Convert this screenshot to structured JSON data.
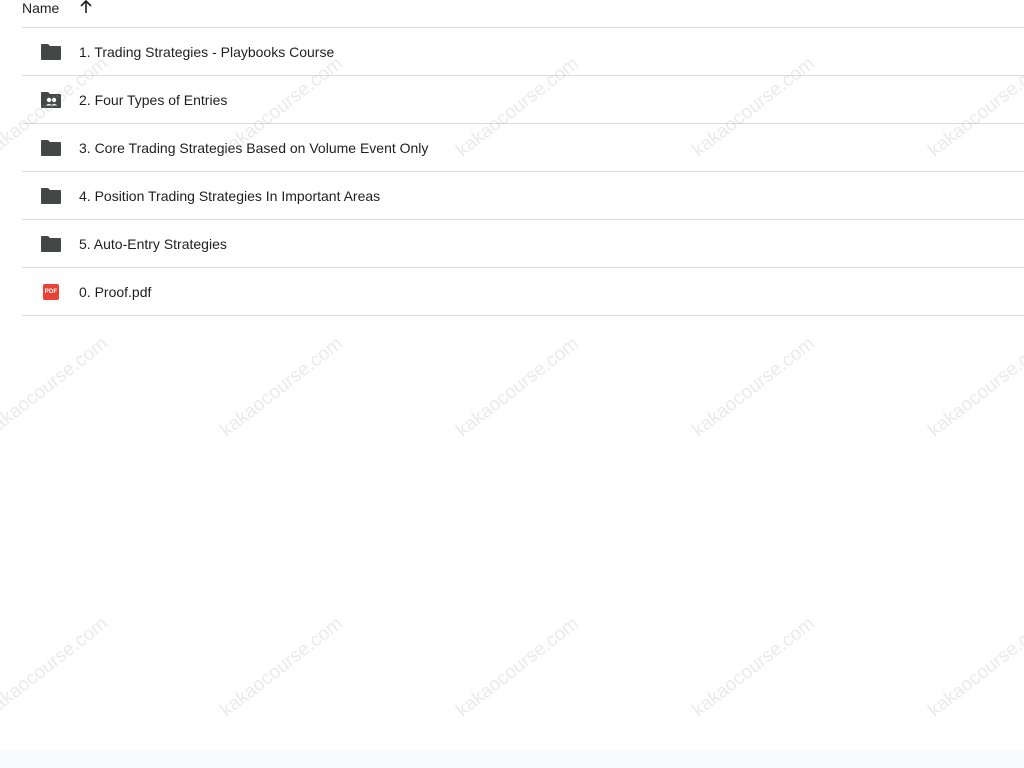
{
  "list_header": {
    "name_label": "Name",
    "sort_icon": "arrow-up-icon"
  },
  "items": [
    {
      "label": "1. Trading Strategies - Playbooks Course",
      "icon": "folder-icon"
    },
    {
      "label": "2. Four Types of Entries",
      "icon": "shared-folder-icon"
    },
    {
      "label": "3. Core Trading Strategies Based on Volume Event Only",
      "icon": "folder-icon"
    },
    {
      "label": "4. Position Trading Strategies In Important Areas",
      "icon": "folder-icon"
    },
    {
      "label": "5. Auto-Entry Strategies",
      "icon": "folder-icon"
    },
    {
      "label": "0. Proof.pdf",
      "icon": "pdf-icon",
      "badge": "PDF"
    }
  ],
  "watermark_text": "kakaocourse.com",
  "colors": {
    "folder": "#444746",
    "pdf": "#ea4335",
    "divider": "#dadce0"
  }
}
